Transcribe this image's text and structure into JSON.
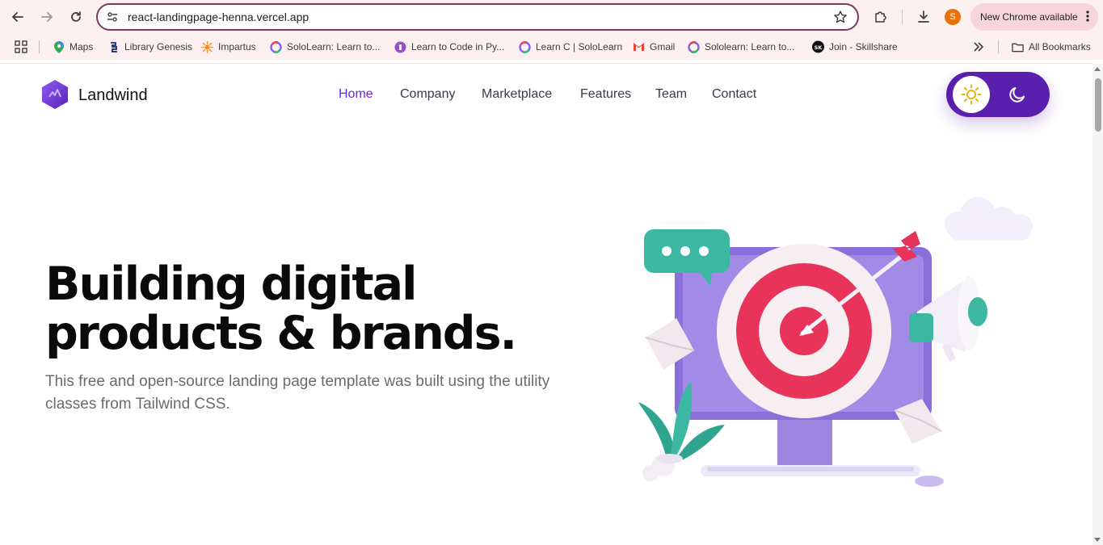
{
  "browser": {
    "url": "react-landingpage-henna.vercel.app",
    "profile_initial": "S",
    "update_label": "New Chrome available",
    "bookmarks": [
      {
        "label": "Maps",
        "icon": "maps-pin-icon"
      },
      {
        "label": "Library Genesis",
        "icon": "library-genesis-icon"
      },
      {
        "label": "Impartus",
        "icon": "impartus-icon"
      },
      {
        "label": "SoloLearn: Learn to...",
        "icon": "sololearn-icon"
      },
      {
        "label": "Learn to Code in Py...",
        "icon": "learn-python-icon"
      },
      {
        "label": "Learn C | SoloLearn",
        "icon": "sololearn-icon"
      },
      {
        "label": "Gmail",
        "icon": "gmail-icon"
      },
      {
        "label": "Sololearn: Learn to...",
        "icon": "sololearn-icon"
      },
      {
        "label": "Join - Skillshare",
        "icon": "skillshare-icon"
      }
    ],
    "all_bookmarks_label": "All Bookmarks",
    "colors": {
      "toolbar_bg": "#fdf0f1",
      "omnibox_border": "#7a3a5a",
      "update_chip": "#f7d5dc"
    }
  },
  "site": {
    "brand": "Landwind",
    "nav": [
      {
        "label": "Home",
        "active": true
      },
      {
        "label": "Company",
        "active": false
      },
      {
        "label": "Marketplace",
        "active": false
      },
      {
        "label": "Features",
        "active": false
      },
      {
        "label": "Team",
        "active": false
      },
      {
        "label": "Contact",
        "active": false
      }
    ],
    "theme_toggle": {
      "light_icon": "sun-icon",
      "dark_icon": "moon-icon",
      "selected": "light"
    },
    "hero": {
      "title_line1": "Building digital",
      "title_line2": "products & brands.",
      "description": "This free and open-source landing page template was built using the utility classes from Tailwind CSS."
    },
    "colors": {
      "accent": "#6d28d9",
      "toggle_bg": "#5b1fae",
      "target_red": "#e8345a",
      "monitor_purple": "#a18be6",
      "teal": "#3cb8a2"
    }
  }
}
